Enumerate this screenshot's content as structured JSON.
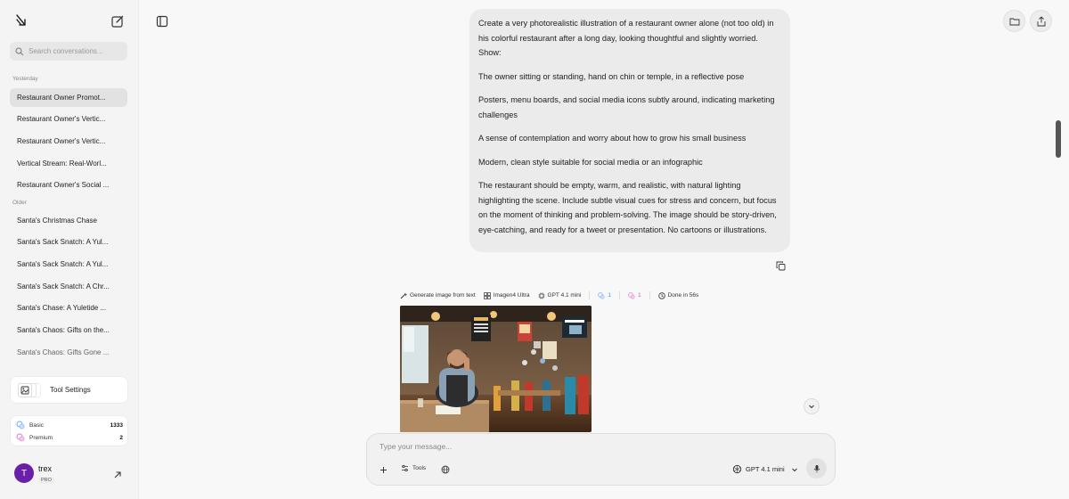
{
  "sidebar": {
    "search_placeholder": "Search conversations...",
    "sections": [
      {
        "label": "Yesterday",
        "items": [
          "Restaurant Owner Promot...",
          "Restaurant Owner's Vertic...",
          "Restaurant Owner's Vertic...",
          "Vertical Stream: Real-Worl...",
          "Restaurant Owner's Social ..."
        ]
      },
      {
        "label": "Older",
        "items": [
          "Santa's Christmas Chase",
          "Santa's Sack Snatch: A Yul...",
          "Santa's Sack Snatch: A Yul...",
          "Santa's Sack Snatch: A Chr...",
          "Santa's Chase: A Yuletide ...",
          "Santa's Chaos: Gifts on the...",
          "Santa's Chaos: Gifts Gone ..."
        ]
      }
    ],
    "tool_settings_label": "Tool Settings",
    "credits": [
      {
        "label": "Basic",
        "value": "1333",
        "color": "#7fb6ff"
      },
      {
        "label": "Premium",
        "value": "2",
        "color": "#e48bd9"
      }
    ],
    "user": {
      "initial": "T",
      "name": "trex",
      "badge": "PRO"
    }
  },
  "message": {
    "paragraphs": [
      "Create a very photorealistic illustration of a restaurant owner alone (not too old) in his colorful restaurant after a long day, looking thoughtful and slightly worried. Show:",
      "The owner sitting or standing, hand on chin or temple, in a reflective pose",
      "Posters, menu boards, and social media icons subtly around, indicating marketing challenges",
      "A sense of contemplation and worry about how to grow his small business",
      "Modern, clean style suitable for social media or an infographic",
      "The restaurant should be empty, warm, and realistic, with natural lighting highlighting the scene. Include subtle visual cues for stress and concern, but focus on the moment of thinking and problem-solving. The image should be story-driven, eye-catching, and ready for a tweet or presentation. No cartoons or illustrations."
    ]
  },
  "generation_meta": {
    "tool": "Generate image from text",
    "model_image": "Imagen4 Ultra",
    "model_text": "GPT 4.1 mini",
    "basic_cost": "1",
    "premium_cost": "1",
    "status": "Done in 56s"
  },
  "composer": {
    "placeholder": "Type your message...",
    "tools_label": "Tools",
    "model_label": "GPT 4.1 mini"
  },
  "colors": {
    "accent_purple": "#6a1fa8",
    "basic_blue": "#7fb6ff",
    "premium_pink": "#e48bd9"
  }
}
